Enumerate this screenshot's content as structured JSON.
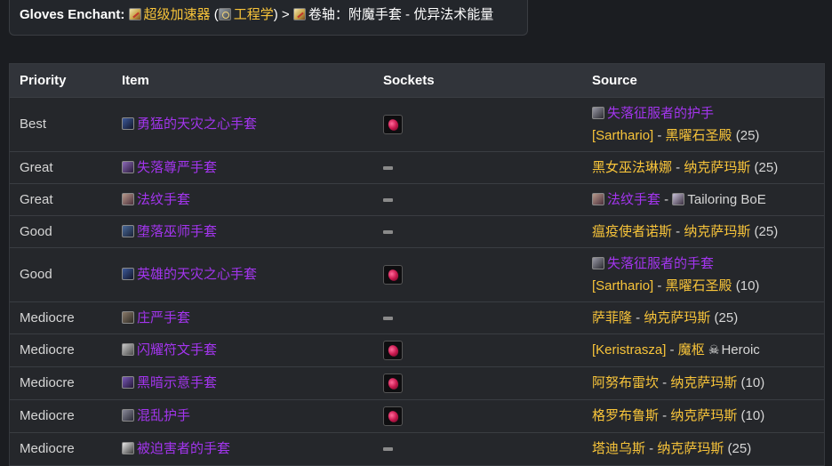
{
  "enchant": {
    "label": "Gloves Enchant",
    "colon": ":",
    "recipe_name": "超级加速器",
    "paren_open": "(",
    "profession": "工程学",
    "paren_close": ")",
    "arrow": ">",
    "scroll_name": "卷轴：附魔手套 - 优异法术能量",
    "icon_recipe": "engineering-gear-icon",
    "icon_profession": "engineering-icon",
    "icon_scroll": "enchant-scroll-icon"
  },
  "colors": {
    "gold": "#f8c43a",
    "epic": "#a335ee",
    "background": "#1b1d21",
    "header": "#31343a"
  },
  "table": {
    "headers": {
      "priority": "Priority",
      "item": "Item",
      "sockets": "Sockets",
      "source": "Source"
    },
    "rows": [
      {
        "priority": "Best",
        "item": "勇猛的天灾之心手套",
        "socket": "red-gem",
        "source_line1": "失落征服者的护手",
        "source_line2_a": "[Sarthario]",
        "sep": " - ",
        "source_line2_b": "黑曜石圣殿",
        "source_line2_c": "(25)"
      },
      {
        "priority": "Great",
        "item": "失落尊严手套",
        "socket": "none",
        "source_a": "黑女巫法琳娜",
        "sep": " - ",
        "source_b": "纳克萨玛斯",
        "source_c": "(25)"
      },
      {
        "priority": "Great",
        "item": "法纹手套",
        "socket": "none",
        "source_a": "法纹手套",
        "sep": " - ",
        "source_b": "Tailoring BoE"
      },
      {
        "priority": "Good",
        "item": "堕落巫师手套",
        "socket": "none",
        "source_a": "瘟疫使者诺斯",
        "sep": " - ",
        "source_b": "纳克萨玛斯",
        "source_c": "(25)"
      },
      {
        "priority": "Good",
        "item": "英雄的天灾之心手套",
        "socket": "red-gem",
        "source_line1": "失落征服者的手套",
        "source_line2_a": "[Sarthario]",
        "sep": " - ",
        "source_line2_b": "黑曜石圣殿",
        "source_line2_c": "(10)"
      },
      {
        "priority": "Mediocre",
        "item": "庄严手套",
        "socket": "none",
        "source_a": "萨菲隆",
        "sep": " - ",
        "source_b": "纳克萨玛斯",
        "source_c": "(25)"
      },
      {
        "priority": "Mediocre",
        "item": "闪耀符文手套",
        "socket": "red-gem",
        "source_a": "[Keristrasza]",
        "sep": " - ",
        "source_b": "魔枢",
        "source_c": "Heroic"
      },
      {
        "priority": "Mediocre",
        "item": "黑暗示意手套",
        "socket": "red-gem",
        "source_a": "阿努布雷坎",
        "sep": " - ",
        "source_b": "纳克萨玛斯",
        "source_c": "(10)"
      },
      {
        "priority": "Mediocre",
        "item": "混乱护手",
        "socket": "red-gem",
        "source_a": "格罗布鲁斯",
        "sep": " - ",
        "source_b": "纳克萨玛斯",
        "source_c": "(10)"
      },
      {
        "priority": "Mediocre",
        "item": "被迫害者的手套",
        "socket": "none",
        "source_a": "塔迪乌斯",
        "sep": " - ",
        "source_b": "纳克萨玛斯",
        "source_c": "(25)"
      }
    ]
  }
}
